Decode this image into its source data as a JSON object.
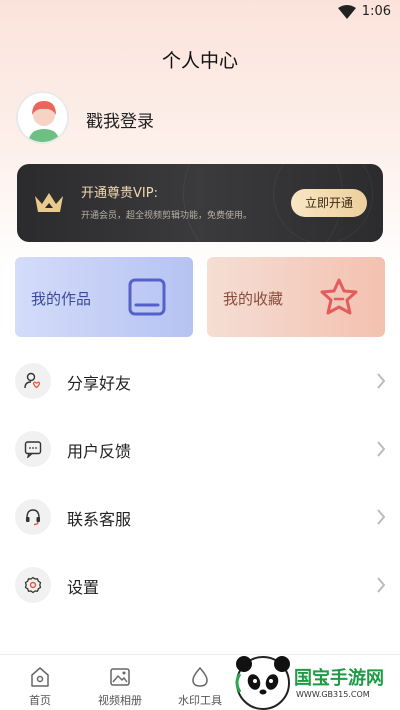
{
  "status_bar": {
    "time": "1:06"
  },
  "header": {
    "title": "个人中心"
  },
  "profile": {
    "login_label": "戳我登录"
  },
  "vip": {
    "title": "开通尊贵VIP:",
    "desc": "开通会员，超全视频剪辑功能，免费使用。",
    "button": "立即开通",
    "accent": "#f1d9b0"
  },
  "cards": {
    "works": "我的作品",
    "favorites": "我的收藏"
  },
  "menu": [
    {
      "label": "分享好友",
      "icon": "share-friend-icon"
    },
    {
      "label": "用户反馈",
      "icon": "feedback-icon"
    },
    {
      "label": "联系客服",
      "icon": "headset-icon"
    },
    {
      "label": "设置",
      "icon": "settings-gear-icon"
    }
  ],
  "tabbar": [
    {
      "label": "首页",
      "icon": "home-icon"
    },
    {
      "label": "视频相册",
      "icon": "album-icon"
    },
    {
      "label": "水印工具",
      "icon": "watermark-drop-icon"
    }
  ],
  "watermark": {
    "brand": "国宝手游网",
    "url": "WWW.GB315.COM"
  }
}
